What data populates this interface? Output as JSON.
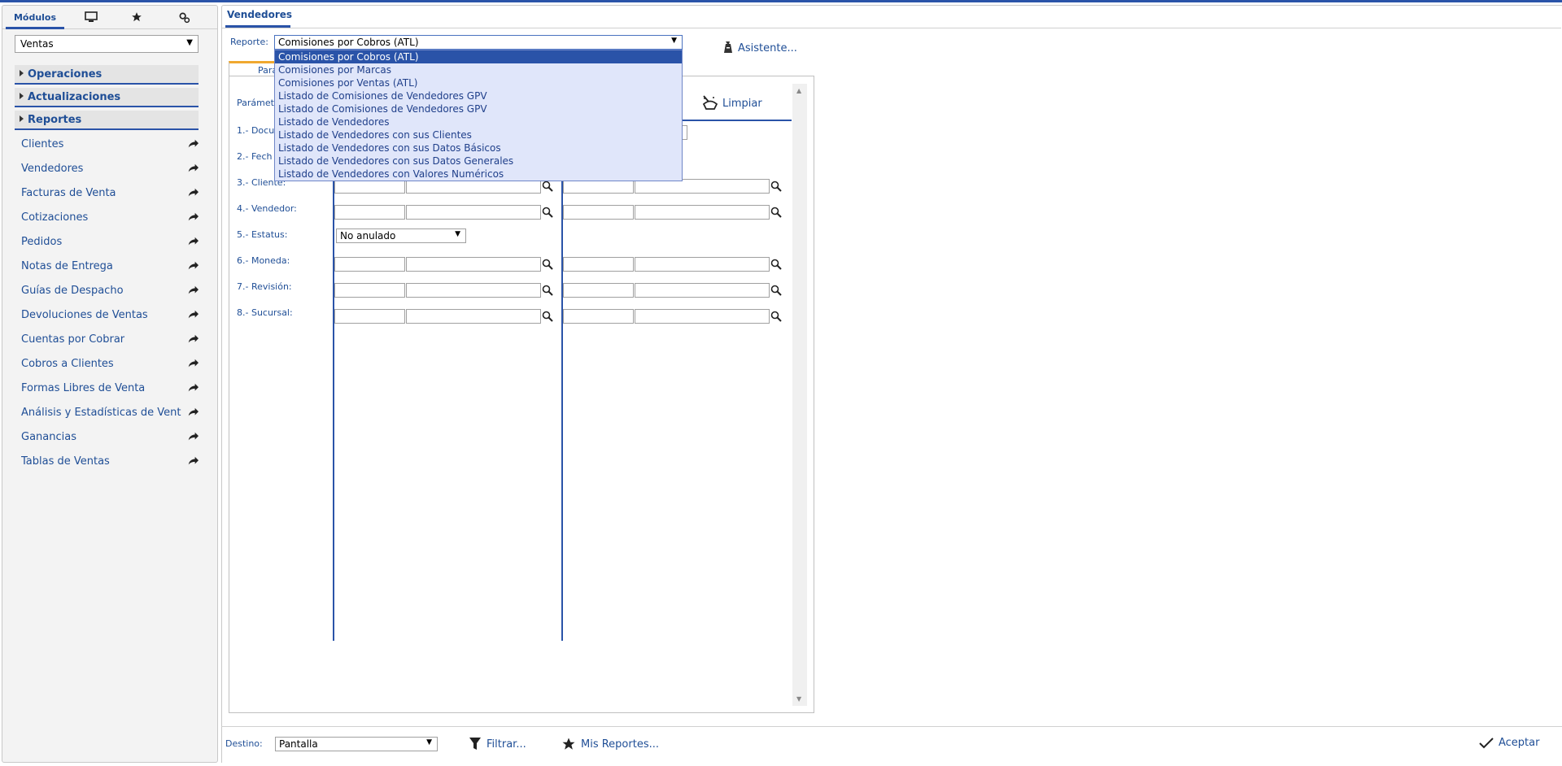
{
  "left": {
    "tabs": [
      {
        "label": "Módulos",
        "icon": "modules-tab"
      },
      {
        "icon": "monitor-icon"
      },
      {
        "icon": "star-icon"
      },
      {
        "icon": "settings-icon"
      }
    ],
    "module_select": "Ventas",
    "sections": [
      "Operaciones",
      "Actualizaciones",
      "Reportes"
    ],
    "items": [
      "Clientes",
      "Vendedores",
      "Facturas de Venta",
      "Cotizaciones",
      "Pedidos",
      "Notas de Entrega",
      "Guías de Despacho",
      "Devoluciones de Ventas",
      "Cuentas por Cobrar",
      "Cobros a Clientes",
      "Formas Libres de Venta",
      "Análisis y Estadísticas de Vent",
      "Ganancias",
      "Tablas de Ventas"
    ]
  },
  "main": {
    "tab": "Vendedores",
    "report_label": "Reporte:",
    "report_selected": "Comisiones por Cobros (ATL)",
    "report_options": [
      "Comisiones por Cobros (ATL)",
      "Comisiones por Marcas",
      "Comisiones por Ventas (ATL)",
      "Listado de Comisiones de Vendedores GPV",
      "Listado de Comisiones de Vendedores GPV",
      "Listado de Vendedores",
      "Listado de Vendedores con sus Clientes",
      "Listado de Vendedores con sus Datos Básicos",
      "Listado de Vendedores con sus Datos Generales",
      "Listado de Vendedores con Valores Numéricos"
    ],
    "asistente": "Asistente...",
    "param_tab": "Para",
    "params_title": "Parámet",
    "limpiar": "Limpiar",
    "rows": [
      "1.- Docu",
      "2.- Fech",
      "3.- Cliente:",
      "4.- Vendedor:",
      "5.- Estatus:",
      "6.- Moneda:",
      "7.- Revisión:",
      "8.- Sucursal:"
    ],
    "estatus_value": "No anulado"
  },
  "bottom": {
    "destino_label": "Destino:",
    "destino_value": "Pantalla",
    "filtrar": "Filtrar...",
    "mis_reportes": "Mis Reportes...",
    "aceptar": "Aceptar"
  }
}
